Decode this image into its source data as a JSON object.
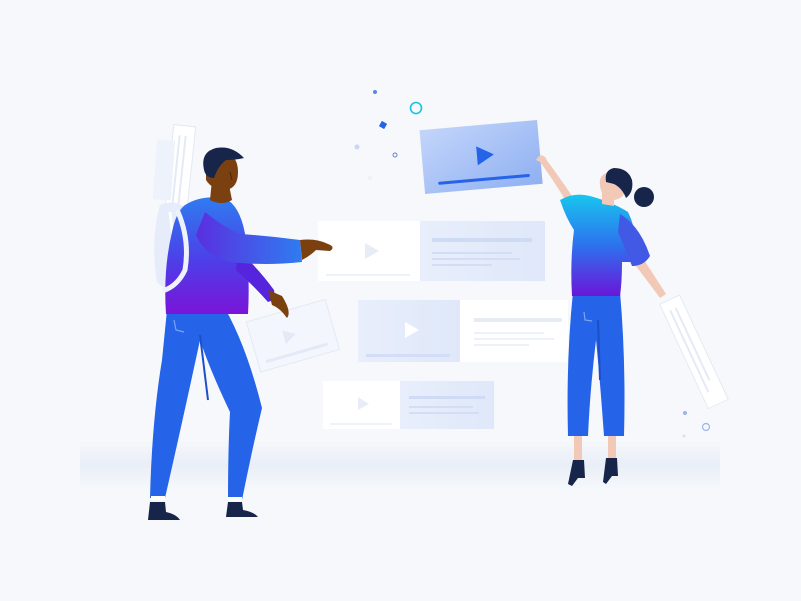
{
  "palette": {
    "background": "#f6f8fb",
    "brand_blue": "#2563e8",
    "deep_purple": "#6b17d9",
    "skin_dark": "#7a4010",
    "hair_navy": "#17254a",
    "accent_cyan": "#19b9e6",
    "card_white": "#ffffff",
    "card_tint": "#e6edfb"
  },
  "icons": [
    "play-icon",
    "confetti-ring-icon",
    "confetti-diamond-icon"
  ]
}
